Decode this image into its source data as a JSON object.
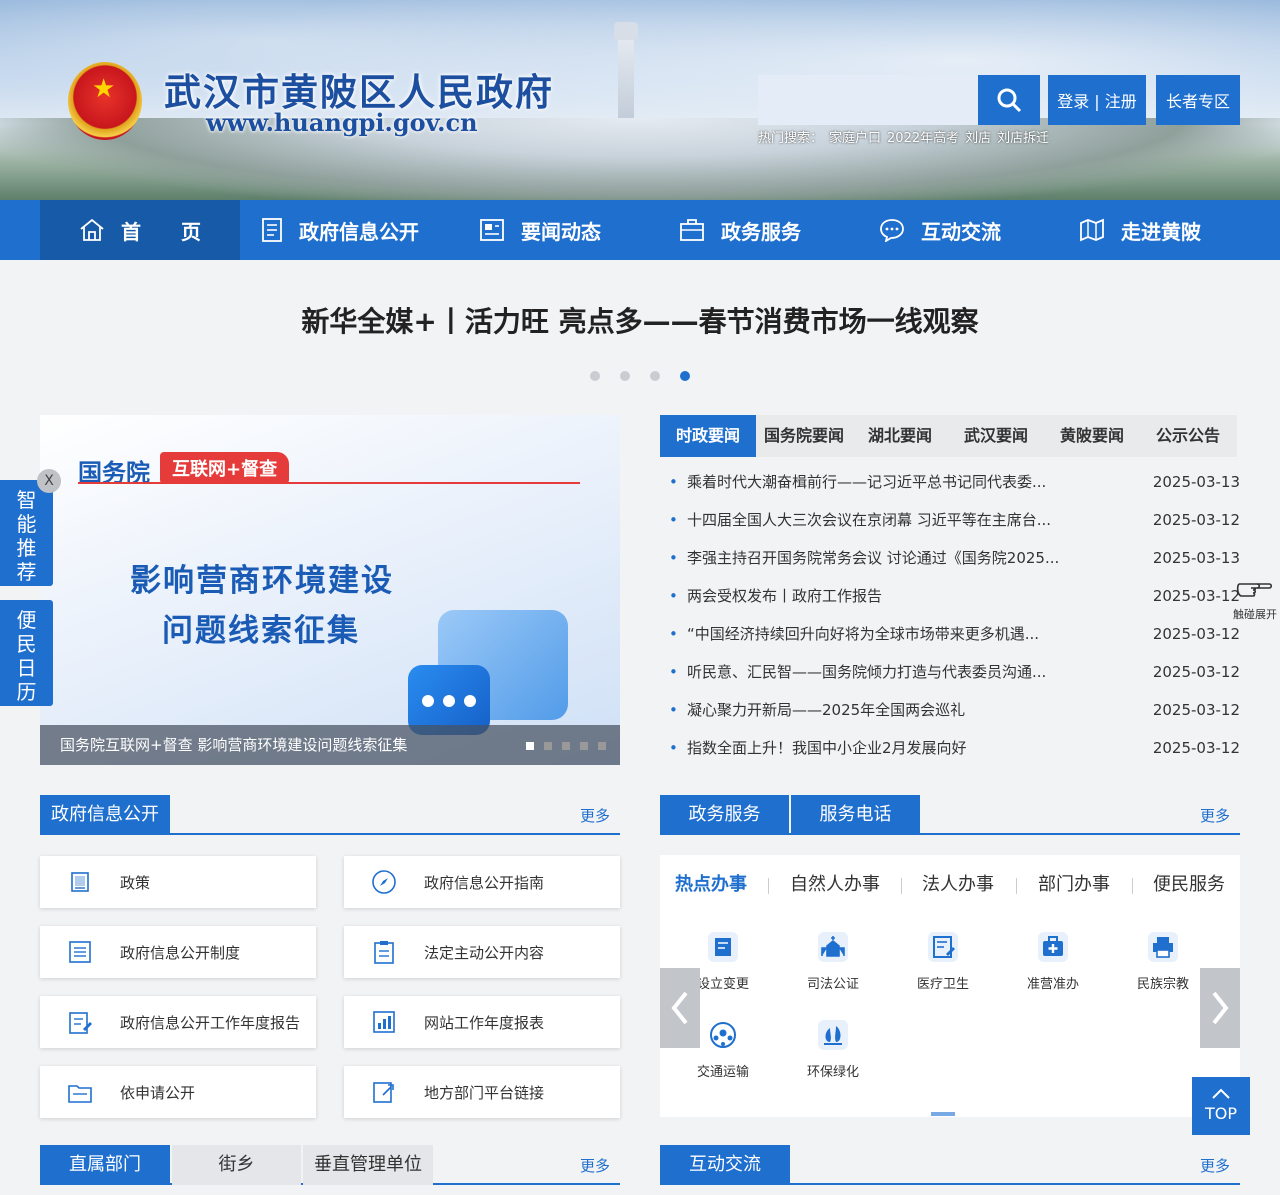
{
  "header": {
    "site_title": "武汉市黄陂区人民政府",
    "site_url": "www.huangpi.gov.cn",
    "search_placeholder": "",
    "login_label": "登录 | 注册",
    "elder_label": "长者专区",
    "hot_prefix": "热门搜索：",
    "hot_terms": [
      "家庭户口",
      "2022年高考",
      "刘店",
      "刘店拆迁"
    ]
  },
  "nav": {
    "items": [
      {
        "label": "首　　页",
        "icon": "home-icon"
      },
      {
        "label": "政府信息公开",
        "icon": "document-icon"
      },
      {
        "label": "要闻动态",
        "icon": "news-icon"
      },
      {
        "label": "政务服务",
        "icon": "briefcase-icon"
      },
      {
        "label": "互动交流",
        "icon": "chat-icon"
      },
      {
        "label": "走进黄陂",
        "icon": "map-icon"
      }
    ]
  },
  "headline": "新华全媒+丨活力旺 亮点多——春节消费市场一线观察",
  "banner": {
    "org": "国务院",
    "tag": "互联网+督查",
    "line1": "影响营商环境建设",
    "line2": "问题线索征集",
    "caption": "国务院互联网+督查 影响营商环境建设问题线索征集"
  },
  "side": {
    "close": "X",
    "smart": "智能推荐",
    "calendar": "便民日历"
  },
  "news_tabs": [
    "时政要闻",
    "国务院要闻",
    "湖北要闻",
    "武汉要闻",
    "黄陂要闻",
    "公示公告"
  ],
  "news": [
    {
      "title": "乘着时代大潮奋楫前行——记习近平总书记同代表委...",
      "date": "2025-03-13"
    },
    {
      "title": "十四届全国人大三次会议在京闭幕 习近平等在主席台...",
      "date": "2025-03-12"
    },
    {
      "title": "李强主持召开国务院常务会议 讨论通过《国务院2025...",
      "date": "2025-03-13"
    },
    {
      "title": "两会受权发布丨政府工作报告",
      "date": "2025-03-12"
    },
    {
      "title": "“中国经济持续回升向好将为全球市场带来更多机遇...",
      "date": "2025-03-12"
    },
    {
      "title": "听民意、汇民智——国务院倾力打造与代表委员沟通...",
      "date": "2025-03-12"
    },
    {
      "title": "凝心聚力开新局——2025年全国两会巡礼",
      "date": "2025-03-12"
    },
    {
      "title": "指数全面上升！我国中小企业2月发展向好",
      "date": "2025-03-12"
    }
  ],
  "touch_label": "触碰展开",
  "info": {
    "title": "政府信息公开",
    "more": "更多",
    "cards": [
      {
        "label": "政策",
        "icon": "book-icon"
      },
      {
        "label": "政府信息公开指南",
        "icon": "compass-icon"
      },
      {
        "label": "政府信息公开制度",
        "icon": "list-icon"
      },
      {
        "label": "法定主动公开内容",
        "icon": "clipboard-icon"
      },
      {
        "label": "政府信息公开工作年度报告",
        "icon": "report-icon"
      },
      {
        "label": "网站工作年度报表",
        "icon": "chart-icon"
      },
      {
        "label": "依申请公开",
        "icon": "folder-icon"
      },
      {
        "label": "地方部门平台链接",
        "icon": "link-icon"
      }
    ]
  },
  "service": {
    "tab1": "政务服务",
    "tab2": "服务电话",
    "more": "更多",
    "subtabs": [
      "热点办事",
      "自然人办事",
      "法人办事",
      "部门办事",
      "便民服务"
    ],
    "items": [
      {
        "label": "设立变更",
        "icon": "edit-doc-icon"
      },
      {
        "label": "司法公证",
        "icon": "church-icon"
      },
      {
        "label": "医疗卫生",
        "icon": "medical-form-icon"
      },
      {
        "label": "准营准办",
        "icon": "medkit-icon"
      },
      {
        "label": "民族宗教",
        "icon": "printer-icon"
      },
      {
        "label": "交通运输",
        "icon": "ball-icon"
      },
      {
        "label": "环保绿化",
        "icon": "tree-icon"
      }
    ]
  },
  "bottom": {
    "dept_tabs": [
      "直属部门",
      "街乡",
      "垂直管理单位"
    ],
    "dept_more": "更多",
    "interact_title": "互动交流",
    "interact_more": "更多"
  },
  "top_label": "TOP",
  "colors": {
    "primary": "#1f6fcf",
    "dark": "#165aa8"
  }
}
